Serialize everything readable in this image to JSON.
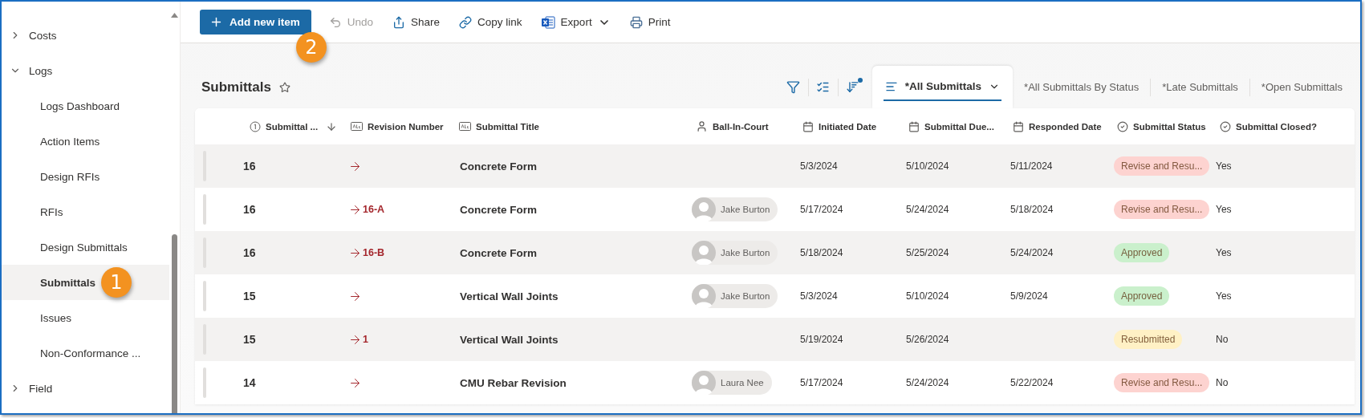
{
  "sidebar": {
    "items": [
      {
        "label": "Costs",
        "expanded": false,
        "selected": false
      },
      {
        "label": "Logs",
        "expanded": true,
        "selected": false,
        "children": [
          {
            "label": "Logs Dashboard",
            "selected": false
          },
          {
            "label": "Action Items",
            "selected": false
          },
          {
            "label": "Design RFIs",
            "selected": false
          },
          {
            "label": "RFIs",
            "selected": false
          },
          {
            "label": "Design Submittals",
            "selected": false
          },
          {
            "label": "Submittals",
            "selected": true,
            "callout": "1"
          },
          {
            "label": "Issues",
            "selected": false
          },
          {
            "label": "Non-Conformance ...",
            "selected": false
          }
        ]
      },
      {
        "label": "Field",
        "expanded": false,
        "selected": false
      }
    ]
  },
  "toolbar": {
    "buttons": [
      {
        "label": "Add new item",
        "kind": "primary",
        "disabled": false,
        "callout": "2"
      },
      {
        "label": "Undo",
        "kind": "plain",
        "disabled": true
      },
      {
        "label": "Share",
        "kind": "plain",
        "disabled": false
      },
      {
        "label": "Copy link",
        "kind": "plain",
        "disabled": false
      },
      {
        "label": "Export",
        "kind": "menu",
        "disabled": false
      },
      {
        "label": "Print",
        "kind": "plain",
        "disabled": false
      }
    ]
  },
  "page": {
    "title": "Submittals",
    "favorite": false
  },
  "view_tabs": [
    {
      "label": "*All Submittals",
      "selected": true
    },
    {
      "label": "*All Submittals By Status",
      "selected": false
    },
    {
      "label": "*Late Submittals",
      "selected": false
    },
    {
      "label": "*Open Submittals",
      "selected": false
    }
  ],
  "table": {
    "columns": [
      {
        "label": "Submittal ...",
        "sorted": true
      },
      {
        "label": "Revision Number",
        "sorted": false
      },
      {
        "label": "Submittal Title",
        "sorted": false
      },
      {
        "label": "Ball-In-Court",
        "sorted": false
      },
      {
        "label": "Initiated Date",
        "sorted": false
      },
      {
        "label": "Submittal Due...",
        "sorted": false
      },
      {
        "label": "Responded Date",
        "sorted": false
      },
      {
        "label": "Submittal Status",
        "sorted": false
      },
      {
        "label": "Submittal Closed?",
        "sorted": false
      }
    ],
    "rows": [
      {
        "number": "16",
        "title": "Concrete Form",
        "initiated": "5/3/2024",
        "due": "5/10/2024",
        "responded": "5/11/2024",
        "status": {
          "label": "Revise and Resu...",
          "color": "#fdd3d0"
        },
        "closed": "Yes"
      },
      {
        "number": "16",
        "revision": "16-A",
        "title": "Concrete Form",
        "ball_in_court": "Jake Burton",
        "initiated": "5/17/2024",
        "due": "5/24/2024",
        "responded": "5/18/2024",
        "status": {
          "label": "Revise and Resu...",
          "color": "#fdd3d0"
        },
        "closed": "Yes"
      },
      {
        "number": "16",
        "revision": "16-B",
        "title": "Concrete Form",
        "ball_in_court": "Jake Burton",
        "initiated": "5/18/2024",
        "due": "5/25/2024",
        "responded": "5/24/2024",
        "status": {
          "label": "Approved",
          "color": "#caf0cc"
        },
        "closed": "Yes"
      },
      {
        "number": "15",
        "title": "Vertical Wall Joints",
        "ball_in_court": "Jake Burton",
        "initiated": "5/3/2024",
        "due": "5/10/2024",
        "responded": "5/9/2024",
        "status": {
          "label": "Approved",
          "color": "#caf0cc"
        },
        "closed": "Yes"
      },
      {
        "number": "15",
        "revision": "1",
        "title": "Vertical Wall Joints",
        "initiated": "5/19/2024",
        "due": "5/26/2024",
        "status": {
          "label": "Resubmitted",
          "color": "#fff1c5"
        },
        "closed": "No"
      },
      {
        "number": "14",
        "title": "CMU Rebar Revision",
        "ball_in_court": "Laura Nee",
        "initiated": "5/17/2024",
        "due": "5/24/2024",
        "responded": "5/22/2024",
        "status": {
          "label": "Revise and Resu...",
          "color": "#fdd3d0"
        },
        "closed": "No"
      }
    ]
  }
}
